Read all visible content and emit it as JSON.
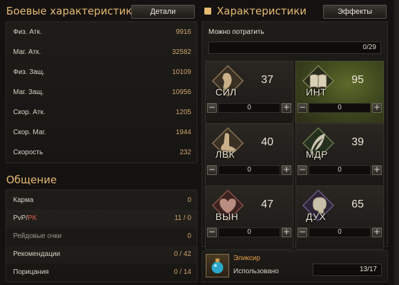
{
  "combat": {
    "title": "Боевые характеристики",
    "details_label": "Детали",
    "stats": [
      {
        "label": "Физ. Атк.",
        "value": "9916"
      },
      {
        "label": "Маг. Атк.",
        "value": "32582"
      },
      {
        "label": "Физ. Защ.",
        "value": "10109"
      },
      {
        "label": "Маг. Защ.",
        "value": "10956"
      },
      {
        "label": "Скор. Атк.",
        "value": "1205"
      },
      {
        "label": "Скор. Маг.",
        "value": "1944"
      },
      {
        "label": "Скорость",
        "value": "232"
      }
    ]
  },
  "social": {
    "title": "Общение",
    "rows": [
      {
        "label": "Карма",
        "value": "0"
      },
      {
        "label_pvp": "PvP",
        "label_sep": "/",
        "label_pk": "PK",
        "value": "11 / 0"
      },
      {
        "label": "Рейдовые очки",
        "value": "0"
      },
      {
        "label": "Рекомендации",
        "value": "0 / 42"
      },
      {
        "label": "Порицания",
        "value": "0 / 14"
      }
    ]
  },
  "attributes": {
    "title": "Характеристики",
    "effects_label": "Эффекты",
    "spendable_label": "Можно потратить",
    "spendable_value": "0/29",
    "cards": [
      {
        "abbr": "СИЛ",
        "value": "37",
        "alloc": "0",
        "icon": "arm-icon"
      },
      {
        "abbr": "ИНТ",
        "value": "95",
        "alloc": "0",
        "icon": "book-icon"
      },
      {
        "abbr": "ЛВК",
        "value": "40",
        "alloc": "0",
        "icon": "foot-icon"
      },
      {
        "abbr": "МДР",
        "value": "39",
        "alloc": "0",
        "icon": "feather-icon"
      },
      {
        "abbr": "ВЫН",
        "value": "47",
        "alloc": "0",
        "icon": "heart-icon"
      },
      {
        "abbr": "ДУХ",
        "value": "65",
        "alloc": "0",
        "icon": "brain-icon"
      }
    ],
    "minus_symbol": "−",
    "plus_symbol": "+"
  },
  "elixir": {
    "title": "Эликсир",
    "used_label": "Использовано",
    "used_value": "13/17",
    "icon": "elixir-bottle-icon"
  },
  "colors": {
    "gold": "#e6ba72",
    "value": "#cfa46a",
    "pk": "#e05b4c",
    "active_card": "#5d6a2a"
  }
}
